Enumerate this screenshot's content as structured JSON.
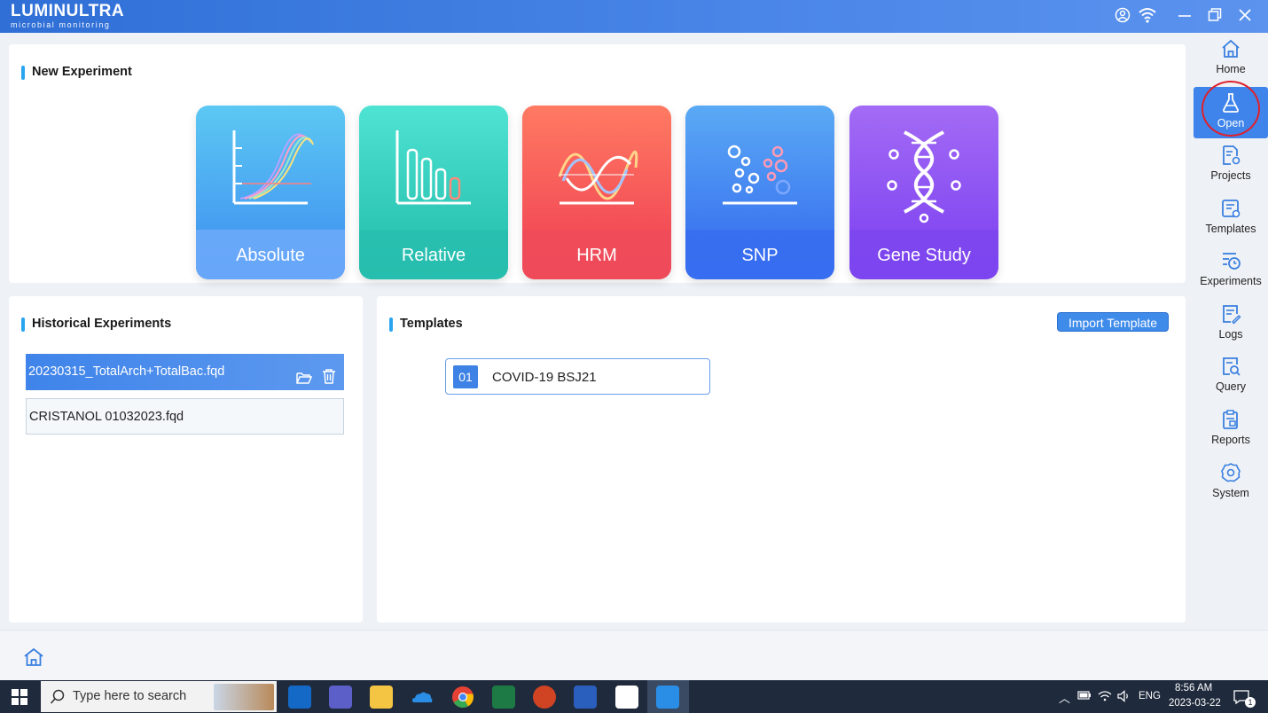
{
  "titlebar": {
    "brand": "LUMINULTRA",
    "tagline": "microbial monitoring",
    "icons": [
      "user-circle-icon",
      "wifi-icon",
      "minimize-icon",
      "restore-icon",
      "close-icon"
    ]
  },
  "new_experiment": {
    "title": "New Experiment",
    "tiles": [
      {
        "label": "Absolute",
        "icon": "amplification-curve-icon",
        "color_top": "#5cc8f3",
        "color_bottom": "#3d8cf0"
      },
      {
        "label": "Relative",
        "icon": "bar-chart-icon",
        "color_top": "#4fe3d3",
        "color_bottom": "#1fb9a8"
      },
      {
        "label": "HRM",
        "icon": "melt-curve-icon",
        "color_top": "#ff7a62",
        "color_bottom": "#ef3c52"
      },
      {
        "label": "SNP",
        "icon": "scatter-dots-icon",
        "color_top": "#5aaaf5",
        "color_bottom": "#3265ee"
      },
      {
        "label": "Gene Study",
        "icon": "dna-icon",
        "color_top": "#a36bf5",
        "color_bottom": "#7a3ef0"
      }
    ]
  },
  "historical": {
    "title": "Historical Experiments",
    "items": [
      {
        "name": "20230315_TotalArch+TotalBac.fqd",
        "selected": true
      },
      {
        "name": "CRISTANOL 01032023.fqd",
        "selected": false
      }
    ]
  },
  "templates": {
    "title": "Templates",
    "import_label": "Import Template",
    "items": [
      {
        "num": "01",
        "name": "COVID-19 BSJ21"
      }
    ]
  },
  "sidebar": {
    "items": [
      {
        "label": "Home",
        "icon": "home-icon",
        "active": false
      },
      {
        "label": "Open",
        "icon": "flask-icon",
        "active": true
      },
      {
        "label": "Projects",
        "icon": "projects-icon",
        "active": false
      },
      {
        "label": "Templates",
        "icon": "templates-icon",
        "active": false
      },
      {
        "label": "Experiments",
        "icon": "experiments-icon",
        "active": false
      },
      {
        "label": "Logs",
        "icon": "logs-icon",
        "active": false
      },
      {
        "label": "Query",
        "icon": "query-icon",
        "active": false
      },
      {
        "label": "Reports",
        "icon": "reports-icon",
        "active": false
      },
      {
        "label": "System",
        "icon": "system-gear-icon",
        "active": false
      }
    ]
  },
  "taskbar": {
    "search_placeholder": "Type here to search",
    "lang": "ENG",
    "time": "8:56 AM",
    "date": "2023-03-22",
    "notifications": "1"
  }
}
